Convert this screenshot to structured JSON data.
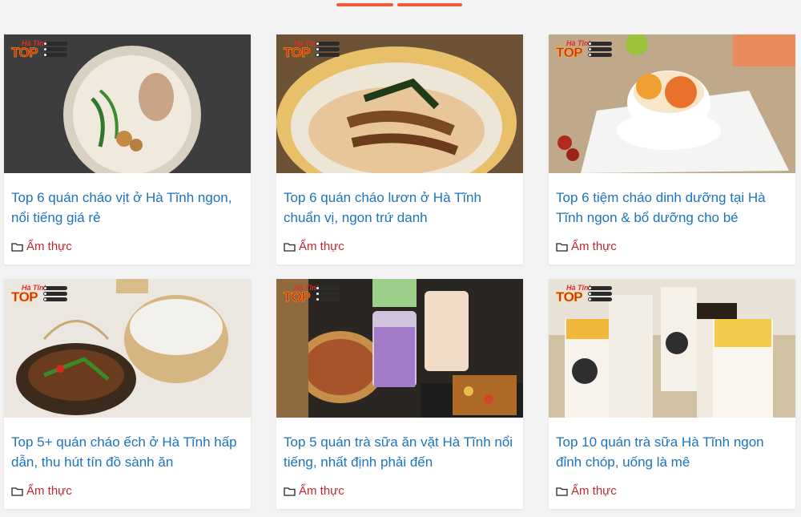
{
  "colors": {
    "accent": "#ef5a3a",
    "title_link": "#1e73be",
    "category_link": "#c0282f"
  },
  "category_icon": "folder-icon",
  "brand_badge": {
    "line1": "Hà Tĩnh",
    "line2": "TOP"
  },
  "cards": [
    {
      "title": "Top 6 quán cháo vịt ở Hà Tĩnh ngon, nổi tiếng giá rẻ",
      "category": "Ẩm thực",
      "image": "duck-porridge-photo"
    },
    {
      "title": "Top 6 quán cháo lươn ở Hà Tĩnh chuẩn vị, ngon trứ danh",
      "category": "Ẩm thực",
      "image": "eel-porridge-photo"
    },
    {
      "title": "Top 6 tiệm cháo dinh dưỡng tại Hà Tĩnh ngon & bổ dưỡng cho bé",
      "category": "Ẩm thực",
      "image": "nutrition-porridge-photo"
    },
    {
      "title": "Top 5+ quán cháo ếch ở Hà Tĩnh hấp dẫn, thu hút tín đồ sành ăn",
      "category": "Ẩm thực",
      "image": "frog-porridge-photo"
    },
    {
      "title": "Top 5 quán trà sữa ăn vặt Hà Tĩnh nổi tiếng, nhất định phải đến",
      "category": "Ẩm thực",
      "image": "milk-tea-snacks-photo"
    },
    {
      "title": "Top 10 quán trà sữa Hà Tĩnh ngon đỉnh chóp, uống là mê",
      "category": "Ẩm thực",
      "image": "milk-tea-cups-photo"
    }
  ]
}
